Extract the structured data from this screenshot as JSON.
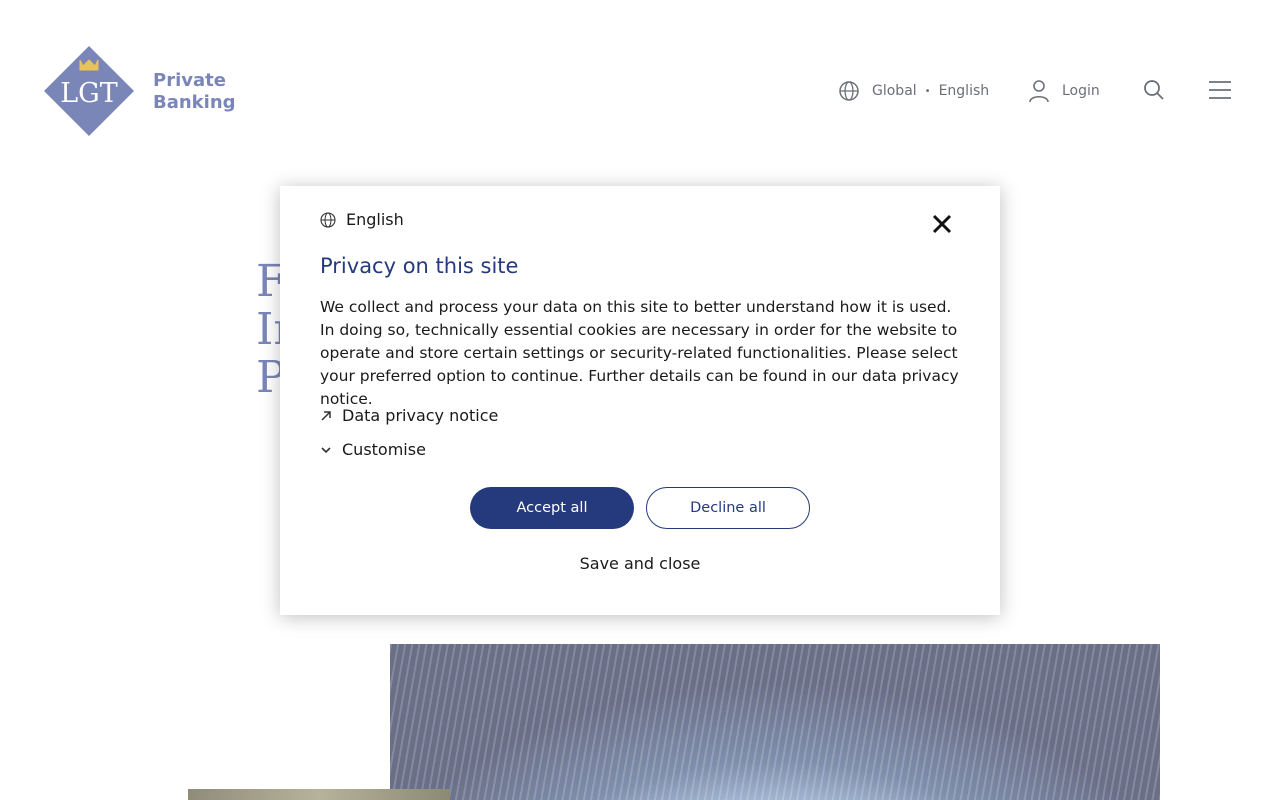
{
  "header": {
    "logo_text": "LGT",
    "brand_line1": "Private",
    "brand_line2": "Banking",
    "region": "Global",
    "separator": "•",
    "language": "English",
    "login_label": "Login"
  },
  "hero": {
    "line1": "F",
    "line2": "In",
    "line3": "P",
    "fragment": "n"
  },
  "modal": {
    "language": "English",
    "title": "Privacy on this site",
    "body": "We collect and process your data on this site to better understand how it is used. In doing so, technically essential cookies are necessary in order for the website to operate and store certain settings or security-related functionalities. Please select your preferred option to continue. Further details can be found in our data privacy notice.",
    "privacy_link": "Data privacy notice",
    "customise_label": "Customise",
    "accept_label": "Accept all",
    "decline_label": "Decline all",
    "save_label": "Save and close"
  },
  "colors": {
    "brand": "#7a86b8",
    "primary": "#253a7d",
    "logo_crown": "#e8c25a"
  },
  "icons": [
    "globe-icon",
    "user-icon",
    "search-icon",
    "menu-icon",
    "close-icon",
    "arrow-up-right-icon",
    "chevron-down-icon"
  ]
}
